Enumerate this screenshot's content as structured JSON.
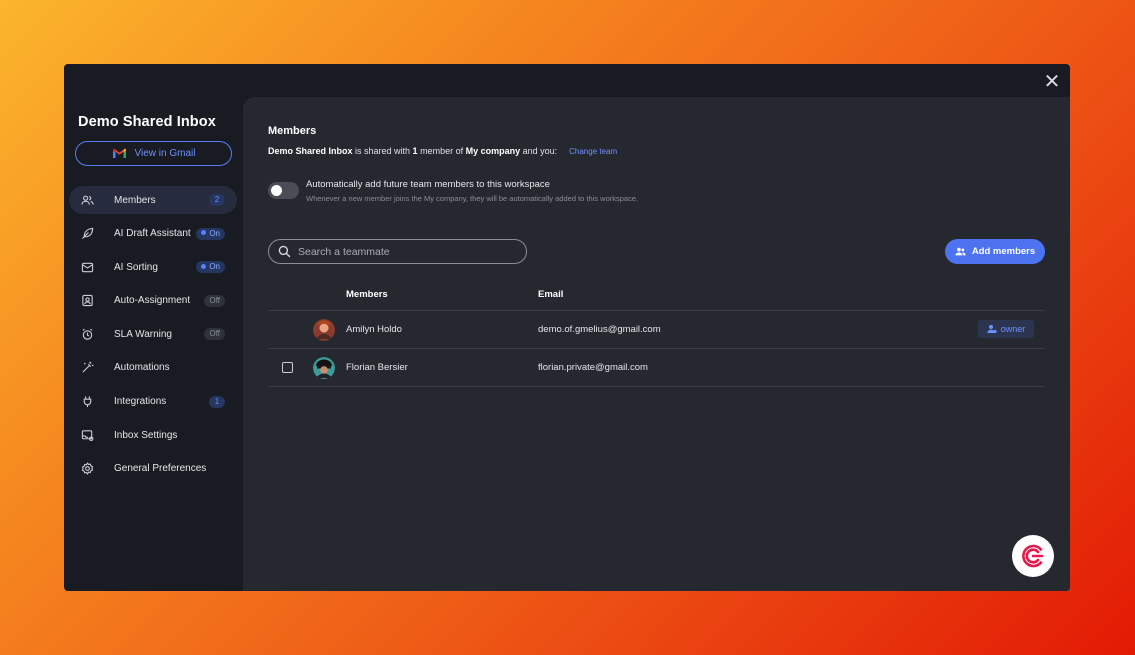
{
  "window": {
    "close_label": "✕"
  },
  "sidebar": {
    "title": "Demo Shared Inbox",
    "gmail_button_label": "View in Gmail",
    "items": [
      {
        "label": "Members",
        "icon": "members-icon",
        "badge": "2",
        "badge_type": "count",
        "active": true
      },
      {
        "label": "AI Draft Assistant",
        "icon": "feather-icon",
        "badge": "On",
        "badge_type": "on"
      },
      {
        "label": "AI Sorting",
        "icon": "sorting-icon",
        "badge": "On",
        "badge_type": "on"
      },
      {
        "label": "Auto-Assignment",
        "icon": "assignment-icon",
        "badge": "Off",
        "badge_type": "off"
      },
      {
        "label": "SLA Warning",
        "icon": "alarm-icon",
        "badge": "Off",
        "badge_type": "off"
      },
      {
        "label": "Automations",
        "icon": "magic-wand-icon"
      },
      {
        "label": "Integrations",
        "icon": "plug-icon",
        "badge": "1",
        "badge_type": "count"
      },
      {
        "label": "Inbox Settings",
        "icon": "inbox-settings-icon"
      },
      {
        "label": "General Preferences",
        "icon": "gear-icon"
      }
    ]
  },
  "main": {
    "title": "Members",
    "share": {
      "inbox_name": "Demo Shared Inbox",
      "text1": " is shared with ",
      "count": "1",
      "text2": " member of ",
      "company": "My company",
      "text3": " and you:",
      "change_team_label": "Change team"
    },
    "toggle": {
      "label": "Automatically add future team members to this workspace",
      "help": "Whenever a new member joins the My company, they will be automatically added to this workspace.",
      "enabled": false
    },
    "search": {
      "placeholder": "Search a teammate"
    },
    "add_button_label": "Add members",
    "table": {
      "headers": {
        "members": "Members",
        "email": "Email"
      },
      "rows": [
        {
          "name": "Amilyn Holdo",
          "email": "demo.of.gmelius@gmail.com",
          "role": "owner"
        },
        {
          "name": "Florian Bersier",
          "email": "florian.private@gmail.com",
          "role": ""
        }
      ]
    }
  },
  "colors": {
    "accent": "#4d73f0",
    "link": "#6f90ff",
    "panel": "#262830",
    "sidebar": "#191b22"
  }
}
